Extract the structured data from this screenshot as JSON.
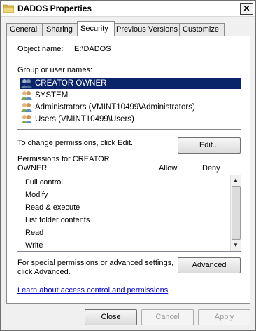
{
  "window": {
    "title": "DADOS Properties",
    "close_glyph": "✕"
  },
  "tabs": [
    {
      "label": "General"
    },
    {
      "label": "Sharing"
    },
    {
      "label": "Security",
      "active": true
    },
    {
      "label": "Previous Versions"
    },
    {
      "label": "Customize"
    }
  ],
  "security": {
    "object_name_label": "Object name:",
    "object_name_value": "E:\\DADOS",
    "groups_label": "Group or user names:",
    "users": [
      {
        "label": "CREATOR OWNER",
        "icon": "users-group-icon",
        "selected": true
      },
      {
        "label": "SYSTEM",
        "icon": "users-group-icon"
      },
      {
        "label": "Administrators (VMINT10499\\Administrators)",
        "icon": "users-group-icon"
      },
      {
        "label": "Users (VMINT10499\\Users)",
        "icon": "users-group-icon"
      }
    ],
    "change_hint": "To change permissions, click Edit.",
    "edit_button": "Edit...",
    "permissions_for_line1": "Permissions for CREATOR",
    "permissions_for_line2": "OWNER",
    "allow_header": "Allow",
    "deny_header": "Deny",
    "permissions": [
      {
        "label": "Full control"
      },
      {
        "label": "Modify"
      },
      {
        "label": "Read & execute"
      },
      {
        "label": "List folder contents"
      },
      {
        "label": "Read"
      },
      {
        "label": "Write"
      }
    ],
    "special_line1": "For special permissions or advanced settings,",
    "special_line2": "click Advanced.",
    "advanced_button": "Advanced",
    "learn_link": "Learn about access control and permissions"
  },
  "footer": {
    "close": "Close",
    "cancel": "Cancel",
    "apply": "Apply"
  },
  "colors": {
    "selection": "#0a246a",
    "link": "#0000cc"
  }
}
